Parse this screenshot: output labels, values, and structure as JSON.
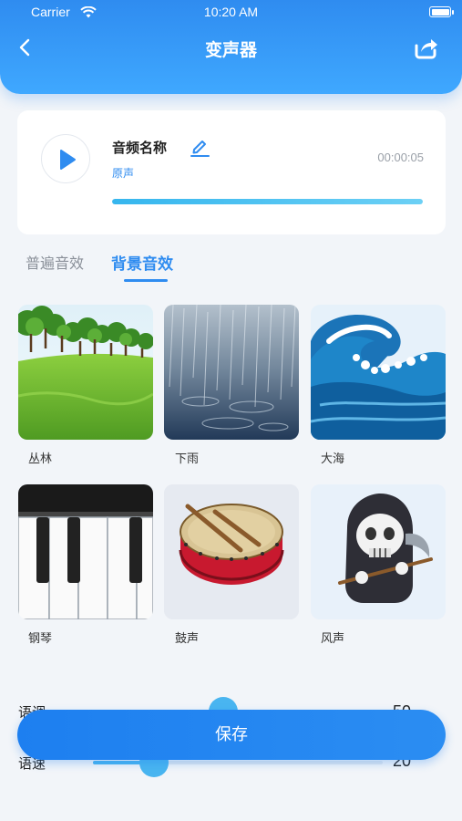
{
  "status_bar": {
    "carrier": "Carrier",
    "time": "10:20 AM"
  },
  "header": {
    "title": "变声器",
    "back_icon": "chevron-left-icon",
    "share_icon": "share-icon"
  },
  "audio": {
    "name": "音频名称",
    "subtitle": "原声",
    "duration": "00:00:05",
    "progress": 1.0,
    "play_icon": "play-icon",
    "edit_icon": "edit-icon"
  },
  "tabs": [
    {
      "label": "普遍音效",
      "active": false
    },
    {
      "label": "背景音效",
      "active": true
    }
  ],
  "effects": [
    {
      "label": "丛林",
      "icon": "forest-image"
    },
    {
      "label": "下雨",
      "icon": "rain-image"
    },
    {
      "label": "大海",
      "icon": "wave-image"
    },
    {
      "label": "钢琴",
      "icon": "piano-image"
    },
    {
      "label": "鼓声",
      "icon": "drum-image"
    },
    {
      "label": "风声",
      "icon": "reaper-image"
    }
  ],
  "sliders": [
    {
      "label": "语调",
      "value": "50",
      "fraction": 0.45
    },
    {
      "label": "语速",
      "value": "20",
      "fraction": 0.21
    }
  ],
  "save_label": "保存",
  "colors": {
    "accent": "#2f8cf0",
    "slider": "#49b5f0",
    "background": "#f2f5f9"
  }
}
